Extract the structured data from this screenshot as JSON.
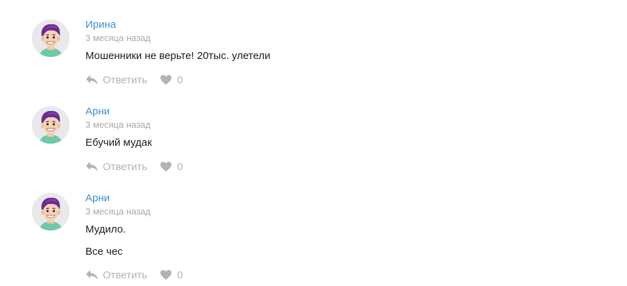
{
  "comments": [
    {
      "author": "Ирина",
      "time": "3 месяца назад",
      "lines": [
        "Мошенники не верьте! 20тыс. улетели"
      ],
      "reply_label": "Ответить",
      "likes": "0"
    },
    {
      "author": "Арни",
      "time": "3 месяца назад",
      "lines": [
        "Ебучий мудак"
      ],
      "reply_label": "Ответить",
      "likes": "0"
    },
    {
      "author": "Арни",
      "time": "3 месяца назад",
      "lines": [
        "Мудило.",
        "Все чес"
      ],
      "reply_label": "Ответить",
      "likes": "0"
    }
  ],
  "icons": {
    "avatar": "cartoon-man-avatar-icon",
    "reply": "reply-arrow-icon",
    "like": "heart-icon"
  },
  "colors": {
    "author": "#3e8ed0",
    "meta": "#a8a8a8",
    "action": "#b3b3b3"
  }
}
